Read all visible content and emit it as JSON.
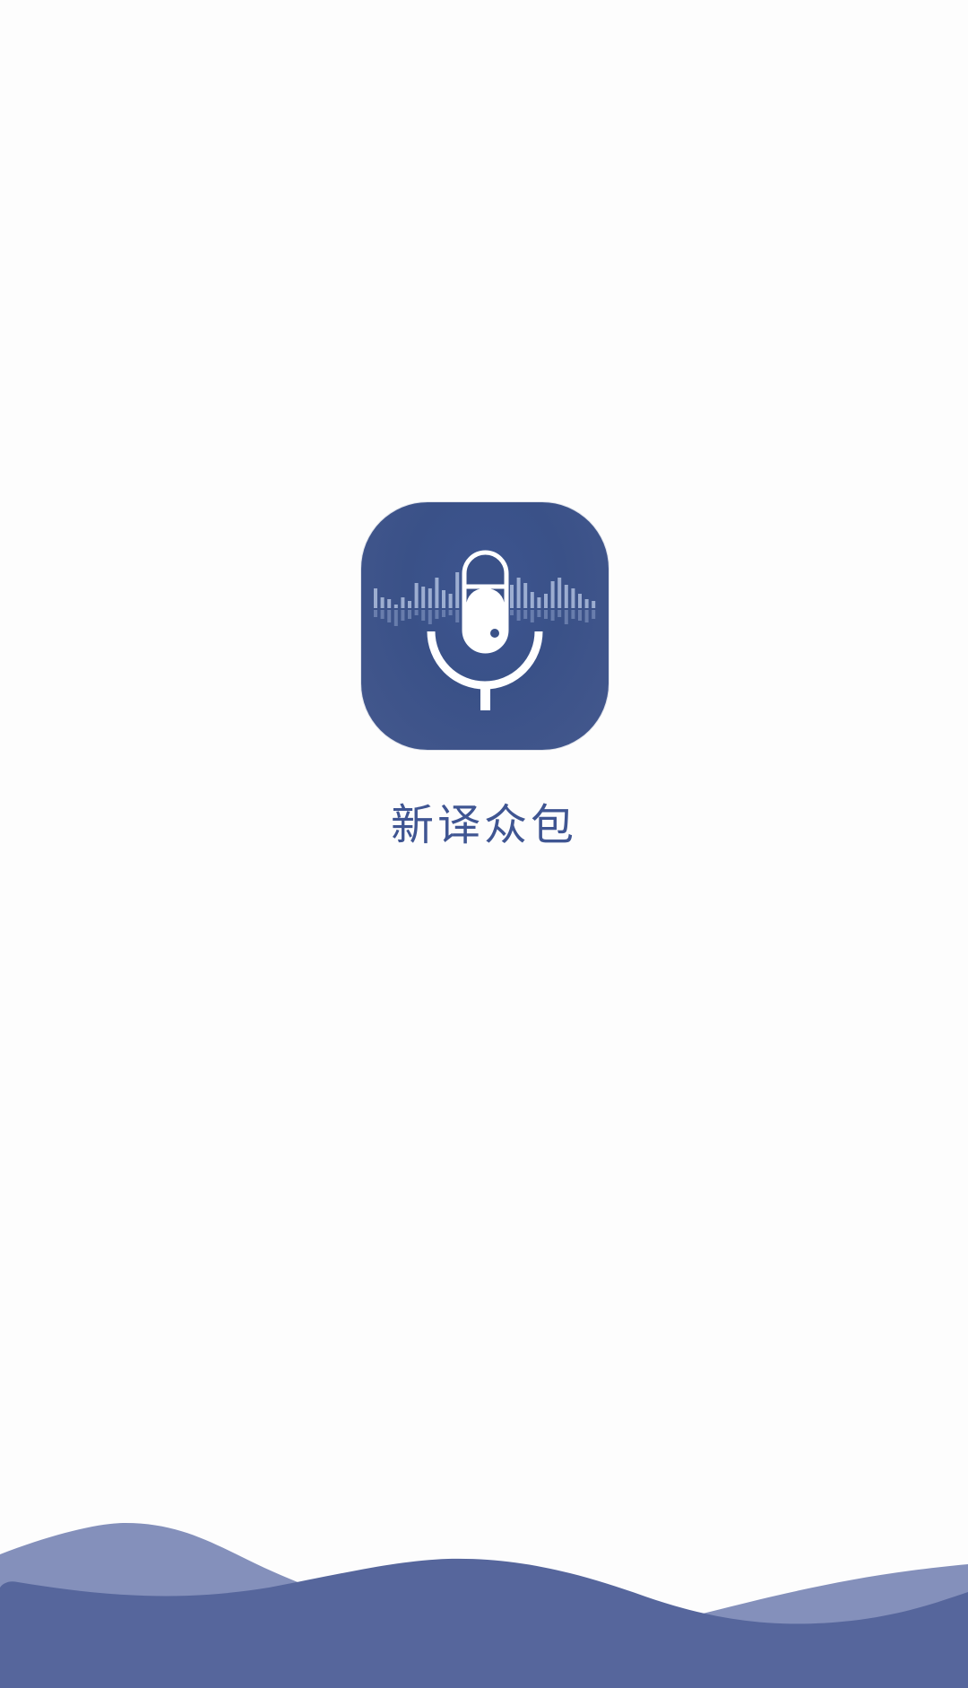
{
  "app": {
    "name": "新译众包",
    "icon": "microphone-soundwave-icon"
  },
  "colors": {
    "background": "#fdfdfd",
    "brand": "#3a5188",
    "title_text": "#3f5592",
    "wave_back": "#8490bb",
    "wave_front": "#56669c"
  }
}
